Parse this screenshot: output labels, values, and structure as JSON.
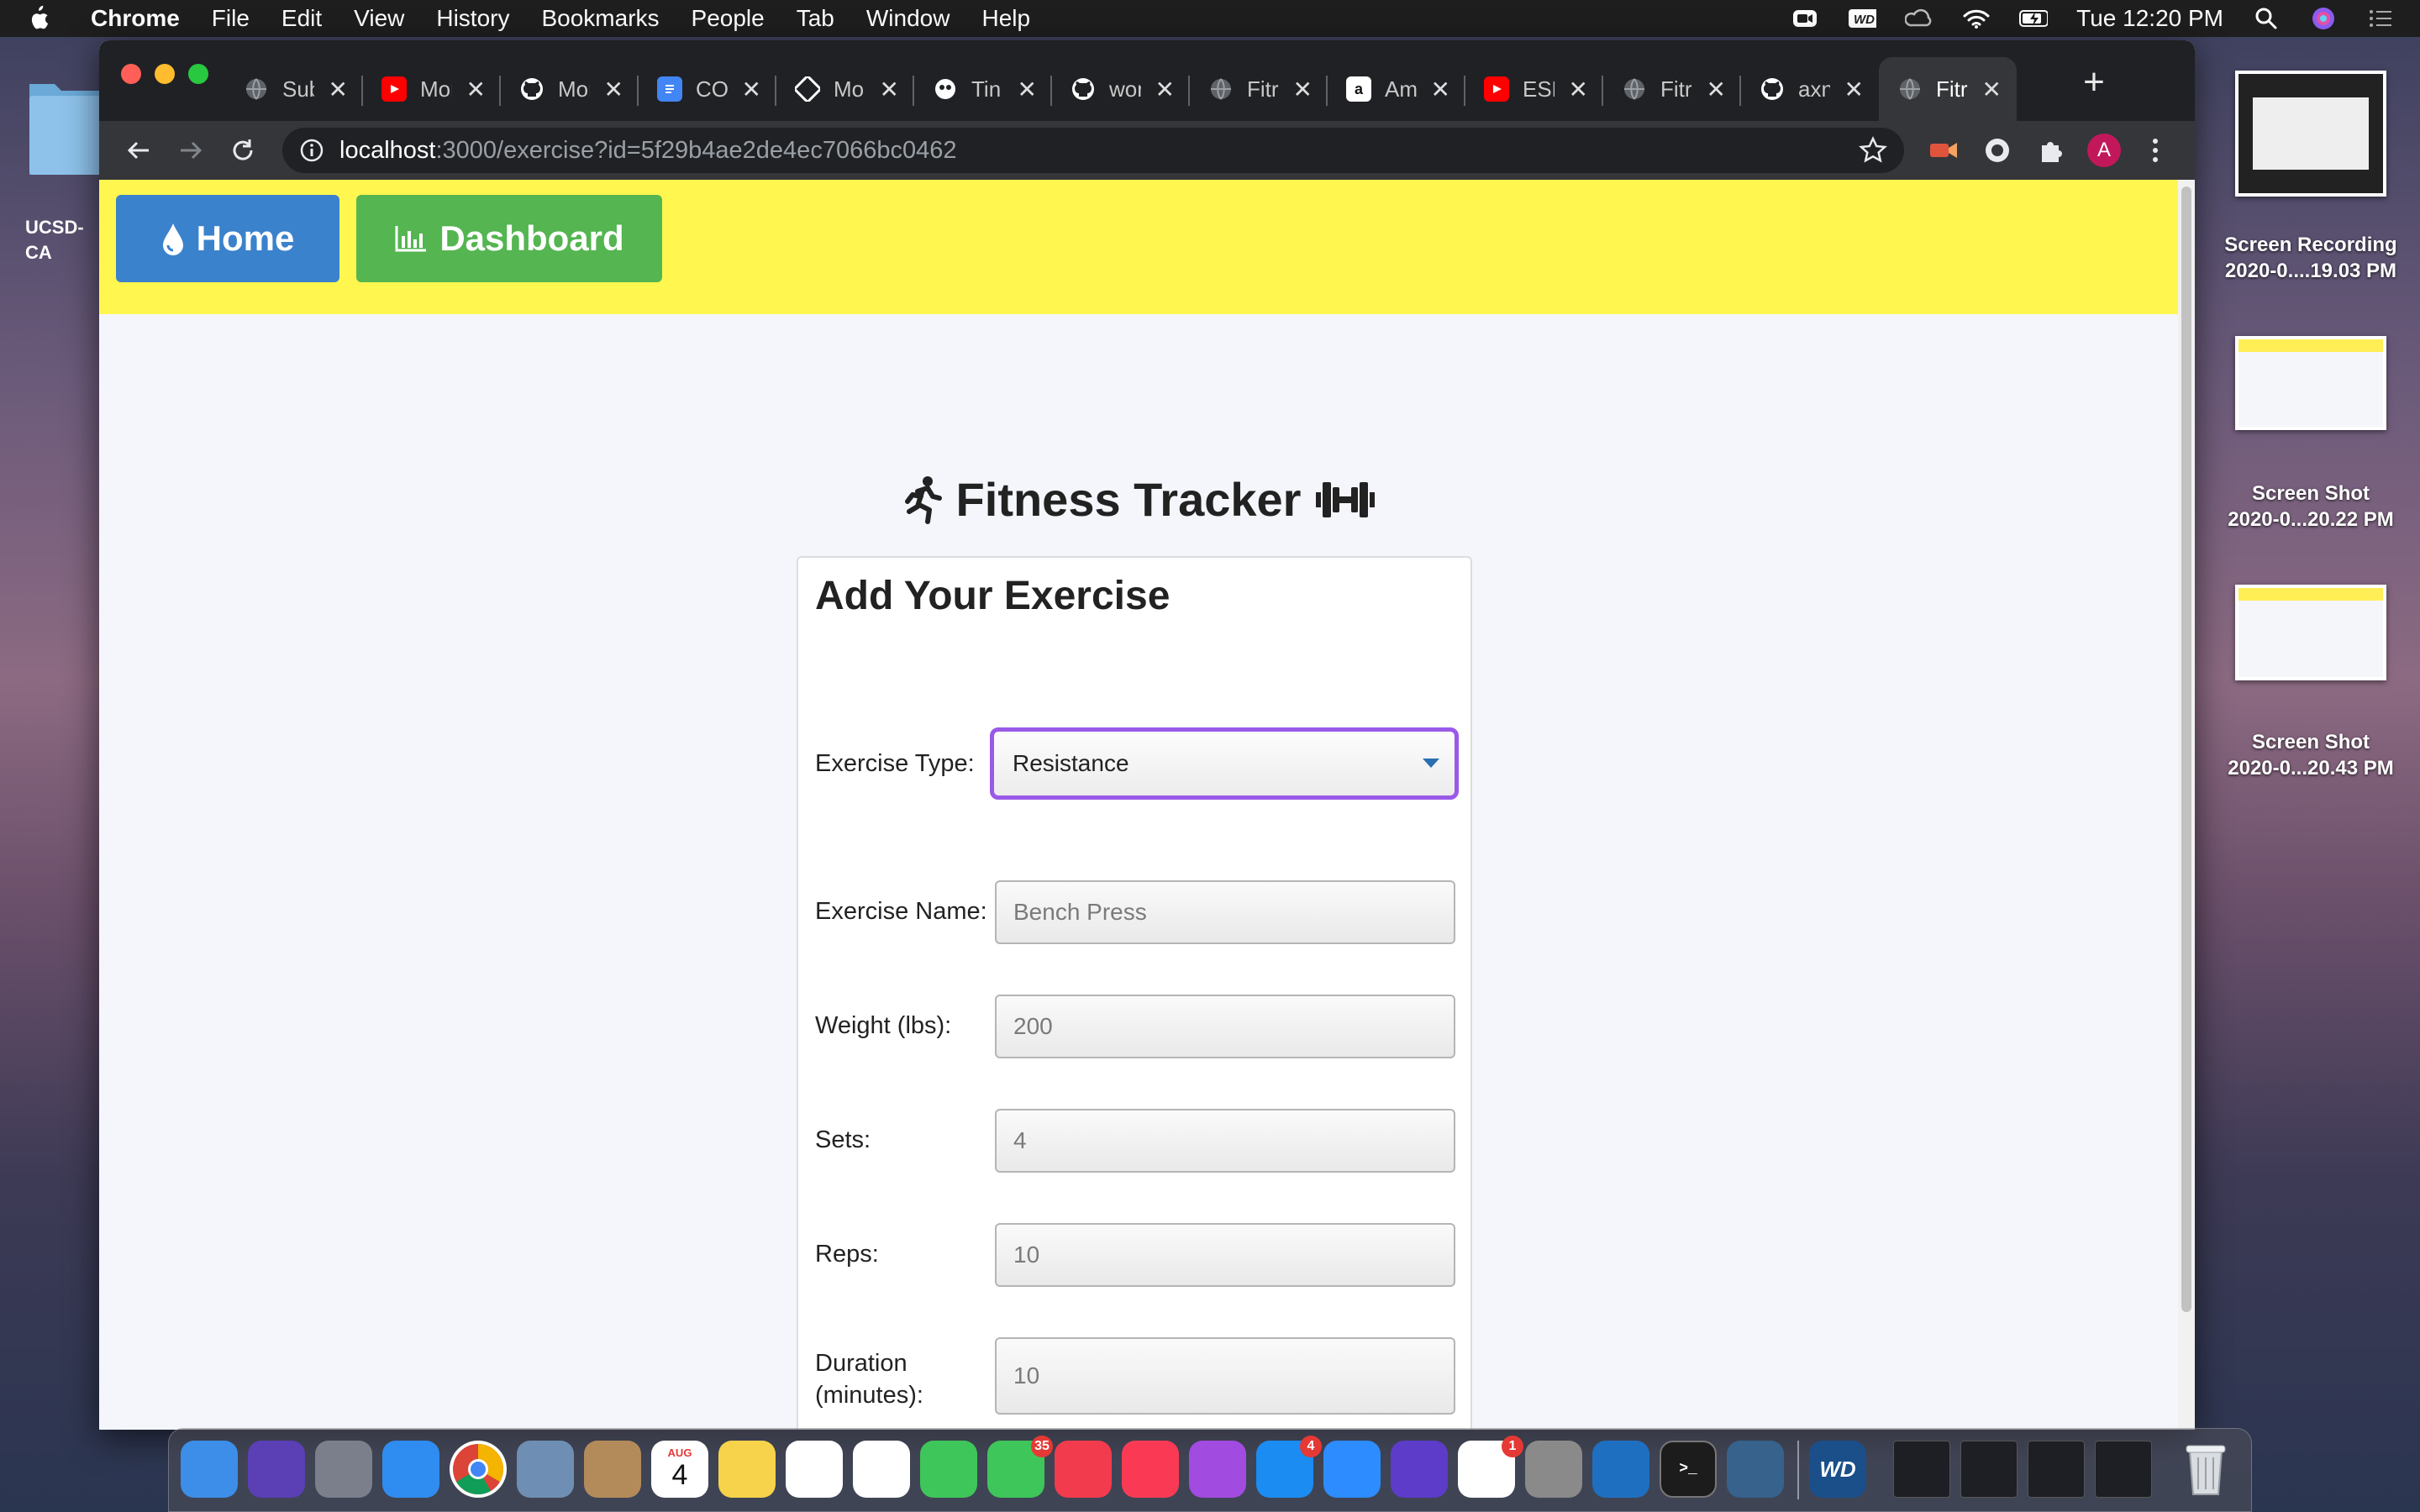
{
  "menubar": {
    "app": "Chrome",
    "items": [
      "File",
      "Edit",
      "View",
      "History",
      "Bookmarks",
      "People",
      "Tab",
      "Window",
      "Help"
    ],
    "clock": "Tue 12:20 PM",
    "status_icons": [
      "zoom-icon",
      "wd-icon",
      "creative-cloud-icon",
      "wifi-icon",
      "battery-icon",
      "spotlight-icon",
      "siri-icon",
      "control-list-icon"
    ]
  },
  "desktop": {
    "folder_label": "UCSD-\nCA",
    "files": [
      {
        "label_line1": "Screen Recording",
        "label_line2": "2020-0....19.03 PM"
      },
      {
        "label_line1": "Screen Shot",
        "label_line2": "2020-0...20.22 PM"
      },
      {
        "label_line1": "Screen Shot",
        "label_line2": "2020-0...20.43 PM"
      }
    ]
  },
  "tabs": [
    {
      "title": "Sub",
      "icon": "globe-icon",
      "color": "#5f6368"
    },
    {
      "title": "Mor",
      "icon": "youtube-icon",
      "color": "#ff0000"
    },
    {
      "title": "Mor",
      "icon": "github-icon",
      "color": "#ffffff"
    },
    {
      "title": "CO",
      "icon": "docs-icon",
      "color": "#4285f4"
    },
    {
      "title": "Mo",
      "icon": "app-icon",
      "color": "#ffffff"
    },
    {
      "title": "Tin",
      "icon": "tinkercad-icon",
      "color": "#ffffff"
    },
    {
      "title": "wor",
      "icon": "github-icon",
      "color": "#ffffff"
    },
    {
      "title": "Fitr",
      "icon": "globe-icon",
      "color": "#5f6368"
    },
    {
      "title": "Am",
      "icon": "amazon-icon",
      "color": "#ffffff"
    },
    {
      "title": "ESL",
      "icon": "youtube-icon",
      "color": "#ff0000"
    },
    {
      "title": "Fitr",
      "icon": "globe-icon",
      "color": "#5f6368"
    },
    {
      "title": "axn",
      "icon": "github-icon",
      "color": "#ffffff"
    },
    {
      "title": "Fitr",
      "icon": "globe-icon",
      "color": "#5f6368",
      "active": true
    }
  ],
  "address_bar": {
    "host": "localhost",
    "path": ":3000/exercise?id=5f29b4ae2de4ec7066bc0462"
  },
  "profile_initial": "A",
  "page": {
    "nav": {
      "home_label": "Home",
      "dashboard_label": "Dashboard",
      "home_color": "#3b82cc",
      "dashboard_color": "#54b551",
      "bar_color": "#fff64f"
    },
    "title": "Fitness Tracker",
    "form": {
      "heading": "Add Your Exercise",
      "exercise_type_label": "Exercise Type:",
      "exercise_type_value": "Resistance",
      "exercise_name_label": "Exercise Name:",
      "exercise_name_placeholder": "Bench Press",
      "weight_label": "Weight (lbs):",
      "weight_placeholder": "200",
      "sets_label": "Sets:",
      "sets_placeholder": "4",
      "reps_label": "Reps:",
      "reps_placeholder": "10",
      "duration_label": "Duration\n(minutes):",
      "duration_placeholder": "10"
    }
  },
  "dock": {
    "apps": [
      {
        "name": "finder"
      },
      {
        "name": "siri"
      },
      {
        "name": "launchpad"
      },
      {
        "name": "safari"
      },
      {
        "name": "chrome"
      },
      {
        "name": "preview"
      },
      {
        "name": "contacts"
      },
      {
        "name": "calendar",
        "month": "AUG",
        "day": "4"
      },
      {
        "name": "notes"
      },
      {
        "name": "reminders"
      },
      {
        "name": "photos"
      },
      {
        "name": "messages"
      },
      {
        "name": "facetime",
        "badge": "35"
      },
      {
        "name": "news"
      },
      {
        "name": "music"
      },
      {
        "name": "podcasts"
      },
      {
        "name": "app-store",
        "badge": "4"
      },
      {
        "name": "zoom"
      },
      {
        "name": "imovie"
      },
      {
        "name": "slack",
        "badge": "1"
      },
      {
        "name": "system-preferences"
      },
      {
        "name": "vscode"
      },
      {
        "name": "terminal"
      },
      {
        "name": "mysql-workbench"
      },
      {
        "name": "wd"
      }
    ]
  }
}
